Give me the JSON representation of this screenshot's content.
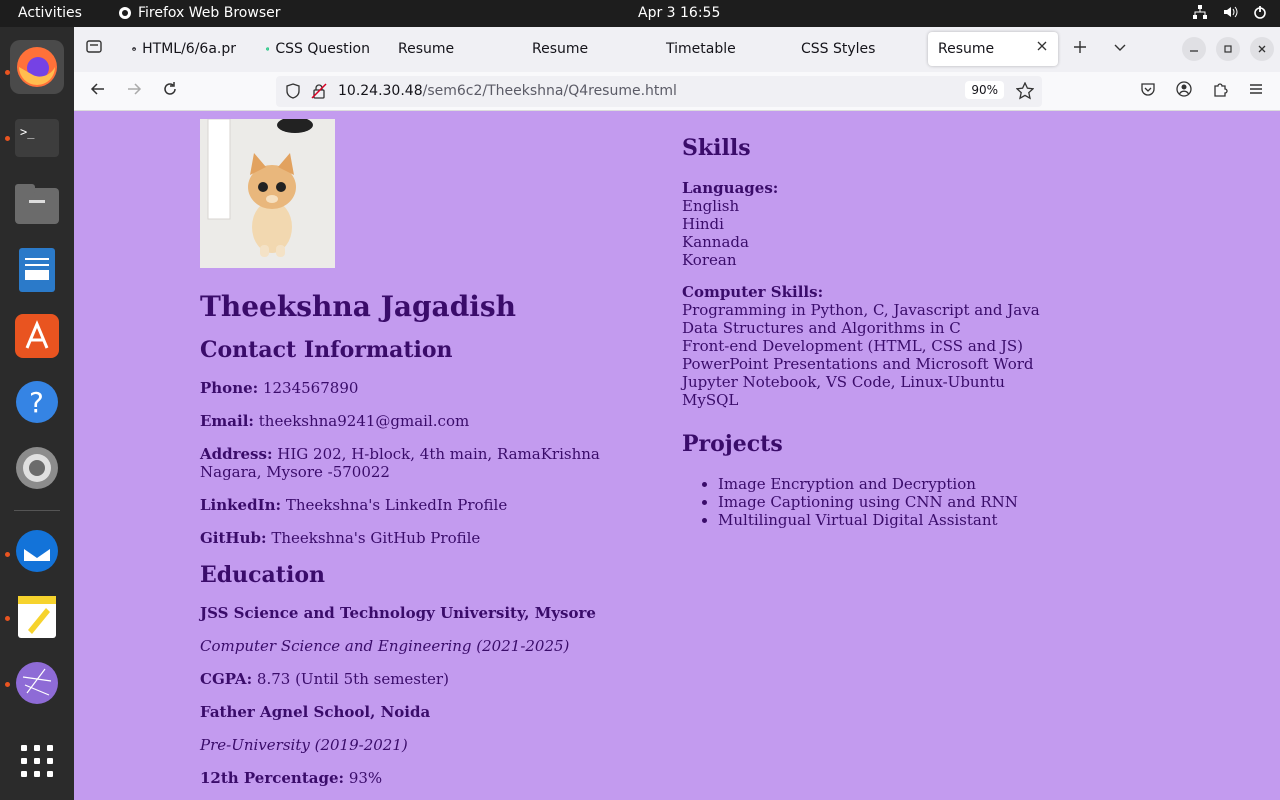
{
  "topbar": {
    "activities": "Activities",
    "app_name": "Firefox Web Browser",
    "clock": "Apr 3  16:55",
    "tray_icons": [
      "network-icon",
      "volume-icon",
      "power-icon"
    ]
  },
  "dock": {
    "items": [
      "firefox",
      "terminal",
      "files",
      "libreoffice-writer",
      "app-center",
      "help",
      "settings",
      "thunderbird",
      "text-editor",
      "network-app",
      "show-apps"
    ]
  },
  "browser": {
    "tabs": [
      {
        "label": "HTML/6/6a.pr",
        "icon": "github-icon"
      },
      {
        "label": "CSS Question",
        "icon": "chatgpt-icon"
      },
      {
        "label": "Resume",
        "icon": ""
      },
      {
        "label": "Resume",
        "icon": ""
      },
      {
        "label": "Timetable",
        "icon": ""
      },
      {
        "label": "CSS Styles",
        "icon": ""
      },
      {
        "label": "Resume",
        "icon": ""
      }
    ],
    "url": {
      "host": "10.24.30.48",
      "path": "/sem6c2/Theekshna/Q4resume.html"
    },
    "zoom": "90%"
  },
  "resume": {
    "name": "Theekshna Jagadish",
    "contact_heading": "Contact Information",
    "contact": [
      {
        "label": "Phone:",
        "value": "1234567890"
      },
      {
        "label": "Email:",
        "value": "theekshna9241@gmail.com"
      },
      {
        "label": "Address:",
        "value": "HIG 202, H-block, 4th main, RamaKrishna Nagara, Mysore -570022"
      },
      {
        "label": "LinkedIn:",
        "value": "Theekshna's LinkedIn Profile"
      },
      {
        "label": "GitHub:",
        "value": "Theekshna's GitHub Profile"
      }
    ],
    "education_heading": "Education",
    "education": {
      "college": "JSS Science and Technology University, Mysore",
      "course": "Computer Science and Engineering (2021-2025)",
      "cgpa_label": "CGPA:",
      "cgpa_value": "8.73 (Until 5th semester)",
      "school": "Father Agnel School, Noida",
      "school_course": "Pre-University (2019-2021)",
      "twelfth_label": "12th Percentage:",
      "twelfth_value": "93%"
    },
    "skills_heading": "Skills",
    "languages_label": "Languages:",
    "languages": [
      "English",
      "Hindi",
      "Kannada",
      "Korean"
    ],
    "computer_skills_label": "Computer Skills:",
    "computer_skills": [
      "Programming in Python, C, Javascript and Java",
      "Data Structures and Algorithms in C",
      "Front-end Development (HTML, CSS and JS)",
      "PowerPoint Presentations and Microsoft Word",
      "Jupyter Notebook, VS Code, Linux-Ubuntu",
      "MySQL"
    ],
    "projects_heading": "Projects",
    "projects": [
      "Image Encryption and Decryption",
      "Image Captioning using CNN and RNN",
      "Multilingual Virtual Digital Assistant"
    ]
  }
}
